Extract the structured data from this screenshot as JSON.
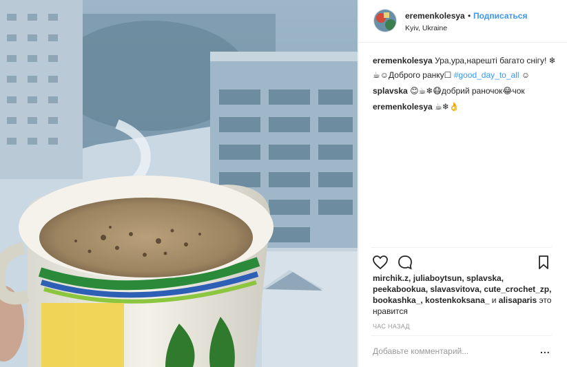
{
  "post": {
    "username": "eremenkolesya",
    "separator": "•",
    "follow_label": "Подписаться",
    "location": "Kyiv, Ukraine"
  },
  "comments": [
    {
      "user": "eremenkolesya",
      "text": "Ура,ура,нарешті багато снігу! ❄☕☺Доброго ранку☐ ",
      "hashtag": "#good_day_to_all",
      "suffix": " ☺"
    },
    {
      "user": "splavska",
      "text": "😊☕❄😷добрий раночок😂чок",
      "hashtag": "",
      "suffix": ""
    },
    {
      "user": "eremenkolesya",
      "text": "☕❄👌",
      "hashtag": "",
      "suffix": ""
    }
  ],
  "actions": {
    "like_icon": "heart-icon",
    "comment_icon": "comment-icon",
    "save_icon": "bookmark-icon"
  },
  "likes": {
    "names_line1": "mirchik.z, juliaboytsun, splavska,",
    "names_line2": "peekabookua, slavasvitova, cute_crochet_zp,",
    "names_line3": "bookashka_, kostenkoksana_",
    "and_word": " и ",
    "last_name": "alisaparis",
    "tail": " это нравится"
  },
  "time_ago": "час назад",
  "add_comment": {
    "placeholder": "Добавьте комментарий...",
    "more_label": "..."
  },
  "colors": {
    "accent": "#3897f0",
    "text": "#262626",
    "muted": "#999999",
    "border": "#efefef"
  }
}
